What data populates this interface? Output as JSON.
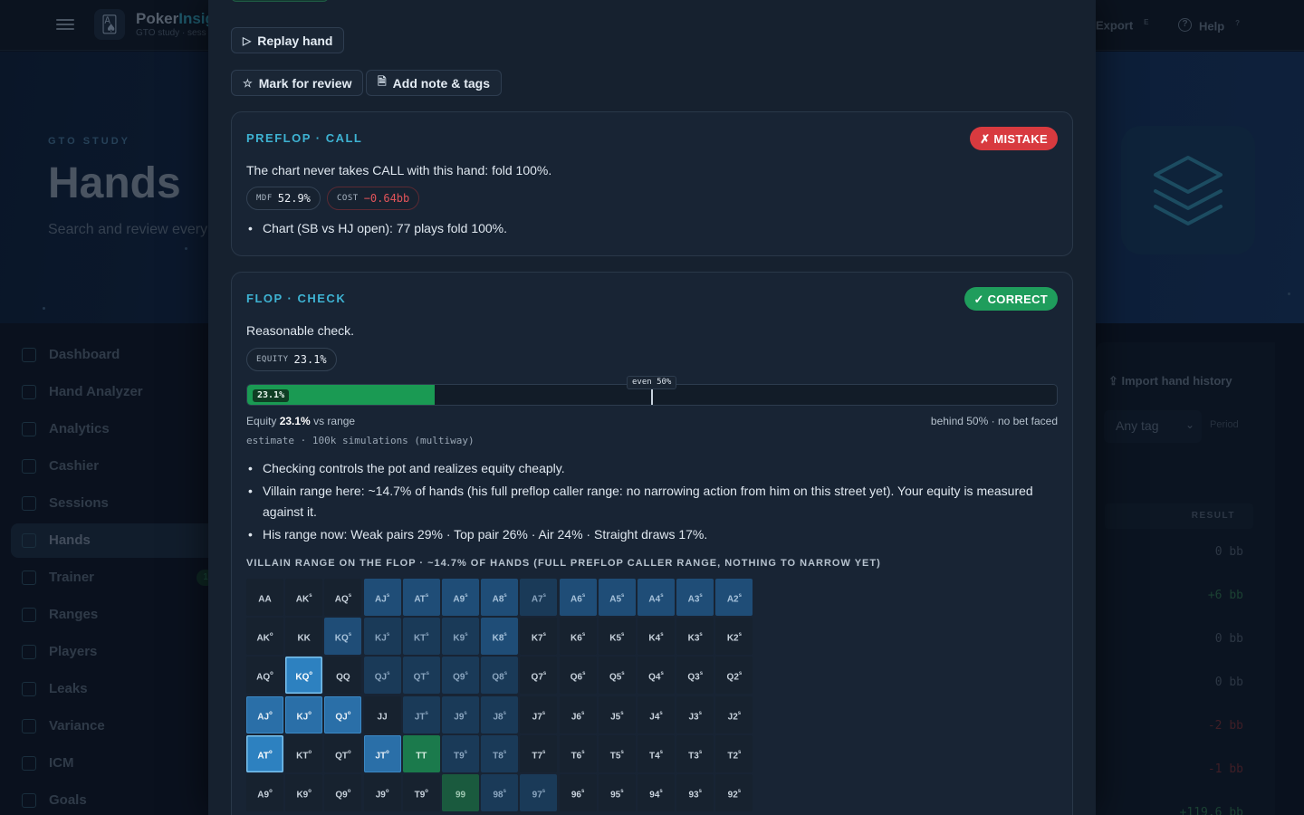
{
  "topbar": {
    "brand_main": "Poker",
    "brand_accent": "Insig",
    "brand_sub": "GTO study · sess",
    "export_label": "Export",
    "export_key": "E",
    "help_label": "Help",
    "help_key": "?",
    "help_glyph": "?"
  },
  "hero": {
    "kicker": "GTO STUDY",
    "title": "Hands",
    "subtitle": "Search and review every"
  },
  "sidebar": {
    "items": [
      {
        "label": "Dashboard",
        "icon": "grid-icon"
      },
      {
        "label": "Hand Analyzer",
        "icon": "target-icon"
      },
      {
        "label": "Analytics",
        "icon": "bar-chart-icon"
      },
      {
        "label": "Cashier",
        "icon": "wallet-icon"
      },
      {
        "label": "Sessions",
        "icon": "clock-icon"
      },
      {
        "label": "Hands",
        "icon": "layers-icon",
        "active": true
      },
      {
        "label": "Trainer",
        "icon": "bolt-icon",
        "badge": "1"
      },
      {
        "label": "Ranges",
        "icon": "book-icon"
      },
      {
        "label": "Players",
        "icon": "users-icon"
      },
      {
        "label": "Leaks",
        "icon": "warning-icon"
      },
      {
        "label": "Variance",
        "icon": "pulse-icon"
      },
      {
        "label": "ICM",
        "icon": "award-icon"
      },
      {
        "label": "Goals",
        "icon": "flag-icon"
      }
    ]
  },
  "right_panel": {
    "import_label": "Import hand history",
    "tag_filter": "Any tag",
    "period_label": "Period",
    "result_header": "RESULT",
    "results": [
      "0 bb",
      "+6 bb",
      "0 bb",
      "0 bb",
      "-2 bb",
      "-1 bb",
      "+119.6 bb"
    ]
  },
  "modal": {
    "replay_label": "Replay hand",
    "mark_review_label": "Mark for review",
    "add_note_label": "Add note & tags",
    "preflop": {
      "title": "PREFLOP · CALL",
      "verdict": "✗ MISTAKE",
      "text": "The chart never takes CALL with this hand: fold 100%.",
      "chips": [
        {
          "key": "MDF",
          "value": "52.9%"
        },
        {
          "key": "COST",
          "value": "−0.64bb"
        }
      ],
      "bullets": [
        "Chart (SB vs HJ open): 77 plays fold 100%."
      ]
    },
    "flop": {
      "title": "FLOP · CHECK",
      "verdict": "✓ CORRECT",
      "text": "Reasonable check.",
      "equity_chip": {
        "key": "EQUITY",
        "value": "23.1%"
      },
      "equity_fraction": 0.231,
      "equity_bar_label": "23.1%",
      "even_fraction": 0.5,
      "even_label": "even 50%",
      "equity_prefix": "Equity",
      "equity_value": "23.1%",
      "equity_suffix": "vs range",
      "equity_right": "behind 50% · no bet faced",
      "estimate": "estimate · 100k simulations (multiway)",
      "bullets": [
        "Checking controls the pot and realizes equity cheaply.",
        "Villain range here: ~14.7% of hands (his full preflop caller range: no narrowing action from him on this street yet). Your equity is measured against it.",
        "His range now: Weak pairs 29% · Top pair 26% · Air 24% · Straight draws 17%."
      ],
      "grid_title": "VILLAIN RANGE ON THE FLOP · ~14.7% OF HANDS (FULL PREFLOP CALLER RANGE, NOTHING TO NARROW YET)",
      "grid_rows": [
        [
          [
            "AA",
            ""
          ],
          [
            "AK",
            "s"
          ],
          [
            "AQ",
            "s"
          ],
          [
            "AJ",
            "s"
          ],
          [
            "AT",
            "s"
          ],
          [
            "A9",
            "s"
          ],
          [
            "A8",
            "s"
          ],
          [
            "A7",
            "s"
          ],
          [
            "A6",
            "s"
          ],
          [
            "A5",
            "s"
          ],
          [
            "A4",
            "s"
          ],
          [
            "A3",
            "s"
          ],
          [
            "A2",
            "s"
          ]
        ],
        [
          [
            "AK",
            "o"
          ],
          [
            "KK",
            ""
          ],
          [
            "KQ",
            "s"
          ],
          [
            "KJ",
            "s"
          ],
          [
            "KT",
            "s"
          ],
          [
            "K9",
            "s"
          ],
          [
            "K8",
            "s"
          ],
          [
            "K7",
            "s"
          ],
          [
            "K6",
            "s"
          ],
          [
            "K5",
            "s"
          ],
          [
            "K4",
            "s"
          ],
          [
            "K3",
            "s"
          ],
          [
            "K2",
            "s"
          ]
        ],
        [
          [
            "AQ",
            "o"
          ],
          [
            "KQ",
            "o"
          ],
          [
            "QQ",
            ""
          ],
          [
            "QJ",
            "s"
          ],
          [
            "QT",
            "s"
          ],
          [
            "Q9",
            "s"
          ],
          [
            "Q8",
            "s"
          ],
          [
            "Q7",
            "s"
          ],
          [
            "Q6",
            "s"
          ],
          [
            "Q5",
            "s"
          ],
          [
            "Q4",
            "s"
          ],
          [
            "Q3",
            "s"
          ],
          [
            "Q2",
            "s"
          ]
        ],
        [
          [
            "AJ",
            "o"
          ],
          [
            "KJ",
            "o"
          ],
          [
            "QJ",
            "o"
          ],
          [
            "JJ",
            ""
          ],
          [
            "JT",
            "s"
          ],
          [
            "J9",
            "s"
          ],
          [
            "J8",
            "s"
          ],
          [
            "J7",
            "s"
          ],
          [
            "J6",
            "s"
          ],
          [
            "J5",
            "s"
          ],
          [
            "J4",
            "s"
          ],
          [
            "J3",
            "s"
          ],
          [
            "J2",
            "s"
          ]
        ],
        [
          [
            "AT",
            "o"
          ],
          [
            "KT",
            "o"
          ],
          [
            "QT",
            "o"
          ],
          [
            "JT",
            "o"
          ],
          [
            "TT",
            ""
          ],
          [
            "T9",
            "s"
          ],
          [
            "T8",
            "s"
          ],
          [
            "T7",
            "s"
          ],
          [
            "T6",
            "s"
          ],
          [
            "T5",
            "s"
          ],
          [
            "T4",
            "s"
          ],
          [
            "T3",
            "s"
          ],
          [
            "T2",
            "s"
          ]
        ],
        [
          [
            "A9",
            "o"
          ],
          [
            "K9",
            "o"
          ],
          [
            "Q9",
            "o"
          ],
          [
            "J9",
            "o"
          ],
          [
            "T9",
            "o"
          ],
          [
            "99",
            ""
          ],
          [
            "98",
            "s"
          ],
          [
            "97",
            "s"
          ],
          [
            "96",
            "s"
          ],
          [
            "95",
            "s"
          ],
          [
            "94",
            "s"
          ],
          [
            "93",
            "s"
          ],
          [
            "92",
            "s"
          ]
        ]
      ],
      "grid_levels": [
        [
          "l0",
          "l0",
          "l0",
          "l2",
          "l2",
          "l2",
          "l2",
          "l1",
          "l2",
          "l2",
          "l2",
          "l2",
          "l2"
        ],
        [
          "l0",
          "l0",
          "l2",
          "l1",
          "l1",
          "l1",
          "l2",
          "l0",
          "l0",
          "l0",
          "l0",
          "l0",
          "l0"
        ],
        [
          "l0",
          "l4",
          "l0",
          "l1",
          "l1",
          "l1",
          "l1",
          "l0",
          "l0",
          "l0",
          "l0",
          "l0",
          "l0"
        ],
        [
          "l3",
          "l3",
          "l3",
          "l0",
          "l1",
          "l1",
          "l1",
          "l0",
          "l0",
          "l0",
          "l0",
          "l0",
          "l0"
        ],
        [
          "l4",
          "l0",
          "l0",
          "l3",
          "g2",
          "l1",
          "l1",
          "l0",
          "l0",
          "l0",
          "l0",
          "l0",
          "l0"
        ],
        [
          "l0",
          "l0",
          "l0",
          "l0",
          "l0",
          "g1",
          "l1",
          "l1",
          "l0",
          "l0",
          "l0",
          "l0",
          "l0"
        ]
      ]
    }
  },
  "colors": {
    "accent": "#3eb3d3",
    "mistake": "#d83a3f",
    "correct": "#1f9d5c",
    "equity_fill": "#1a9a53"
  }
}
